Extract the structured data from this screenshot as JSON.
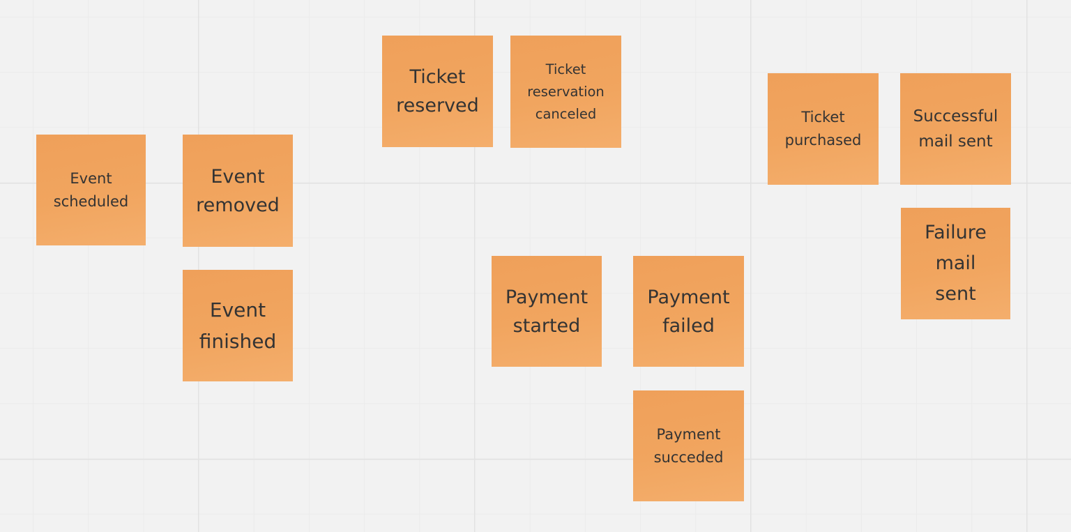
{
  "board": {
    "background_color": "#f2f2f2",
    "sticky_color": "#f1a45e",
    "text_color": "#333333"
  },
  "stickies": {
    "event_scheduled": "Event\nscheduled",
    "event_removed": "Event\nremoved",
    "event_finished": "Event\nfinished",
    "ticket_reserved": "Ticket\nreserved",
    "ticket_reservation_canceled": "Ticket\nreservation\ncanceled",
    "payment_started": "Payment\nstarted",
    "payment_failed": "Payment\nfailed",
    "payment_succeeded": "Payment\nsucceded",
    "ticket_purchased": "Ticket\npurchased",
    "successful_mail_sent": "Successful\nmail sent",
    "failure_mail_sent": "Failure\nmail\nsent"
  }
}
